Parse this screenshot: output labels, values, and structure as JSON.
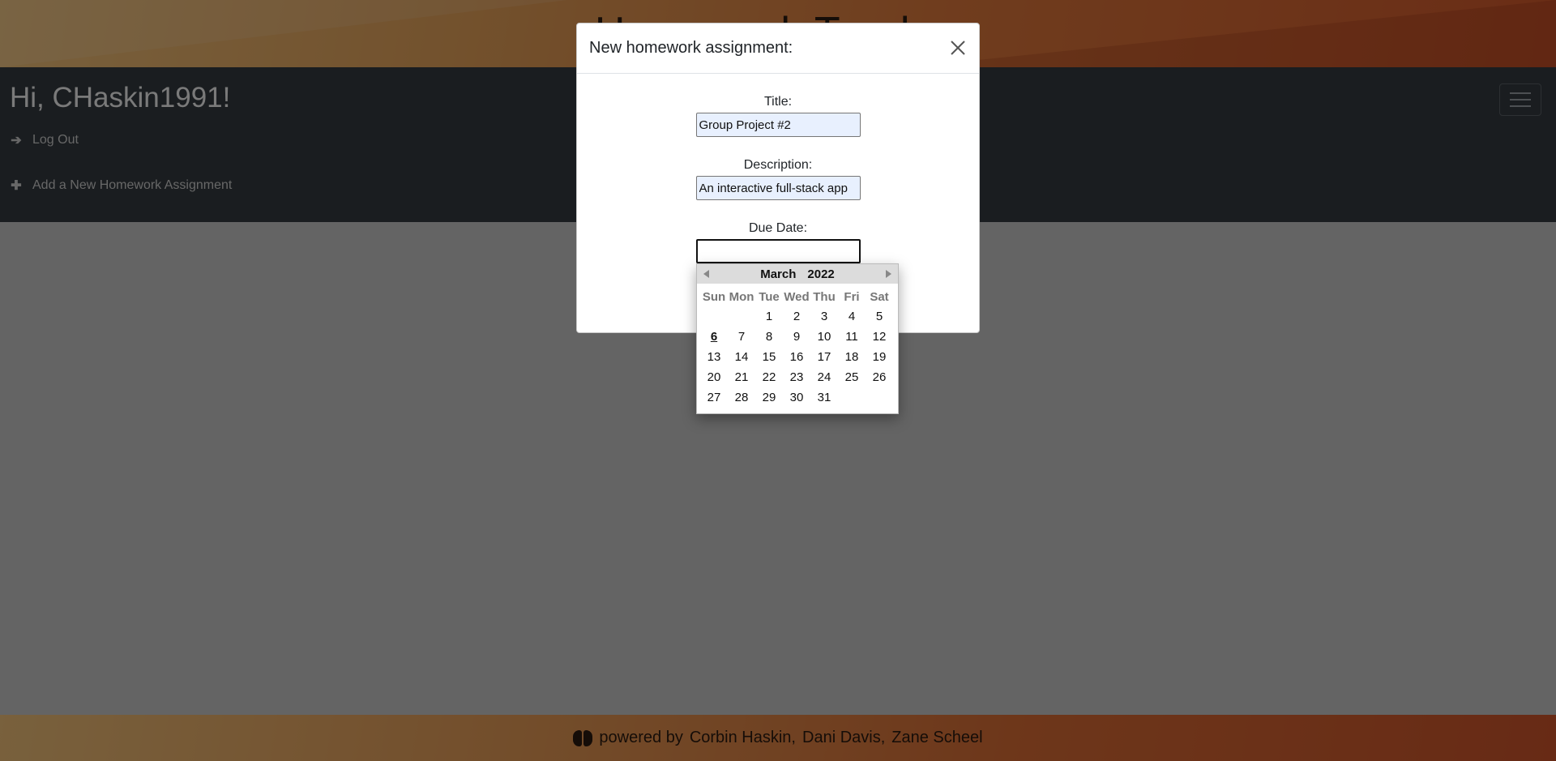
{
  "header": {
    "title": "Homework Tracker"
  },
  "navbar": {
    "greeting": "Hi, CHaskin1991!",
    "logout_label": "Log Out",
    "add_label": "Add a New Homework Assignment"
  },
  "footer": {
    "powered_by": "powered by",
    "authors": [
      "Corbin Haskin,",
      "Dani Davis,",
      "Zane Scheel"
    ]
  },
  "modal": {
    "title": "New homework assignment:",
    "fields": {
      "title_label": "Title:",
      "title_value": "Group Project #2",
      "description_label": "Description:",
      "description_value": "An interactive full-stack app",
      "due_label": "Due Date:",
      "due_value": ""
    }
  },
  "datepicker": {
    "month": "March",
    "year": "2022",
    "weekdays": [
      "Sun",
      "Mon",
      "Tue",
      "Wed",
      "Thu",
      "Fri",
      "Sat"
    ],
    "weeks": [
      [
        "",
        "",
        "1",
        "2",
        "3",
        "4",
        "5"
      ],
      [
        "6",
        "7",
        "8",
        "9",
        "10",
        "11",
        "12"
      ],
      [
        "13",
        "14",
        "15",
        "16",
        "17",
        "18",
        "19"
      ],
      [
        "20",
        "21",
        "22",
        "23",
        "24",
        "25",
        "26"
      ],
      [
        "27",
        "28",
        "29",
        "30",
        "31",
        "",
        ""
      ]
    ],
    "today": "6"
  },
  "icons": {
    "logout": "arrow-right-icon",
    "add": "plus-icon",
    "close": "close-icon",
    "footer": "brain-icon",
    "menu": "hamburger-icon"
  }
}
